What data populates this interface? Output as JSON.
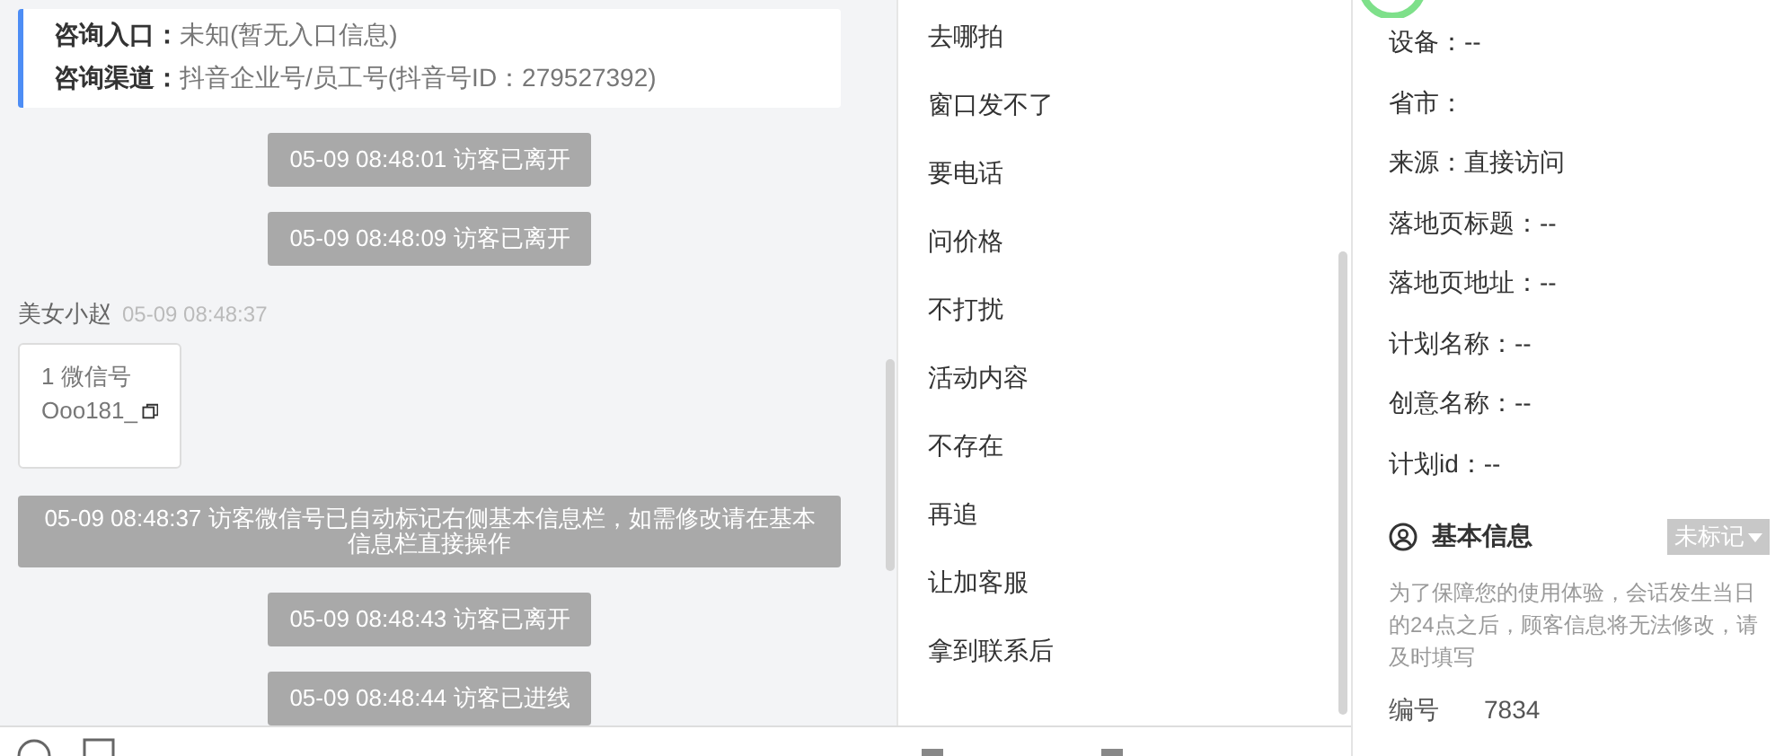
{
  "info_card": {
    "rows": [
      {
        "label": "咨询入口：",
        "value": "未知(暂无入口信息)"
      },
      {
        "label": "咨询渠道：",
        "value": "抖音企业号/员工号(抖音号ID：279527392)"
      }
    ]
  },
  "chat": {
    "messages": [
      {
        "kind": "system",
        "text": "05-09 08:48:01 访客已离开"
      },
      {
        "kind": "system",
        "text": "05-09 08:48:09 访客已离开"
      },
      {
        "kind": "message",
        "sender": "美女小赵",
        "time": "05-09 08:48:37",
        "lines": [
          "1 微信号",
          "Ooo181_"
        ]
      },
      {
        "kind": "notice",
        "text": "05-09 08:48:37 访客微信号已自动标记右侧基本信息栏，如需修改请在基本信息栏直接操作"
      },
      {
        "kind": "system",
        "text": "05-09 08:48:43 访客已离开"
      },
      {
        "kind": "system",
        "text": "05-09 08:48:44 访客已进线"
      }
    ]
  },
  "quick_replies": [
    "去哪拍",
    "窗口发不了",
    "要电话",
    "问价格",
    "不打扰",
    "活动内容",
    "不存在",
    "再追",
    "让加客服",
    "拿到联系后"
  ],
  "visitor_info": [
    "设备：--",
    "省市：",
    "来源：直接访问",
    "落地页标题：--",
    "落地页地址：--",
    "计划名称：--",
    "创意名称：--",
    "计划id：--"
  ],
  "basic_info": {
    "title": "基本信息",
    "badge": "未标记",
    "note": "为了保障您的使用体验，会话发生当日的24点之后，顾客信息将无法修改，请及时填写",
    "fields": [
      {
        "label": "编号",
        "value": "7834"
      }
    ]
  }
}
